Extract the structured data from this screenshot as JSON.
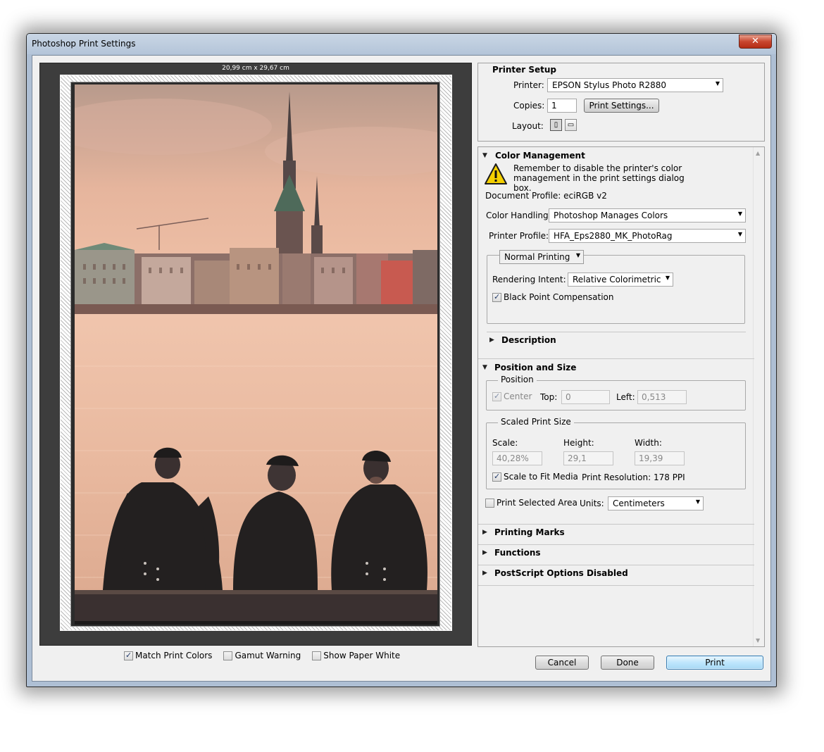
{
  "window": {
    "title": "Photoshop Print Settings",
    "close_label": "✕"
  },
  "preview": {
    "paper_size": "20,99 cm x 29,67 cm",
    "options": [
      {
        "label": "Match Print Colors",
        "checked": true
      },
      {
        "label": "Gamut Warning",
        "checked": false
      },
      {
        "label": "Show Paper White",
        "checked": false
      }
    ]
  },
  "printer_setup": {
    "title": "Printer Setup",
    "printer_label": "Printer:",
    "printer_value": "EPSON Stylus Photo R2880",
    "copies_label": "Copies:",
    "copies_value": "1",
    "print_settings_button": "Print Settings...",
    "layout_label": "Layout:"
  },
  "color_management": {
    "title": "Color Management",
    "warning": "Remember to disable the printer's color management in the print settings dialog box.",
    "document_profile": "Document Profile: eciRGB v2",
    "color_handling_label": "Color Handling:",
    "color_handling_value": "Photoshop Manages Colors",
    "printer_profile_label": "Printer Profile:",
    "printer_profile_value": "HFA_Eps2880_MK_PhotoRag",
    "mode_value": "Normal Printing",
    "rendering_intent_label": "Rendering Intent:",
    "rendering_intent_value": "Relative Colorimetric",
    "black_point_label": "Black Point Compensation",
    "black_point_checked": true,
    "description_title": "Description"
  },
  "position_size": {
    "title": "Position and Size",
    "position_legend": "Position",
    "center_label": "Center",
    "top_label": "Top:",
    "top_value": "0",
    "left_label": "Left:",
    "left_value": "0,513",
    "scaled_legend": "Scaled Print Size",
    "scale_label": "Scale:",
    "scale_value": "40,28%",
    "height_label": "Height:",
    "height_value": "29,1",
    "width_label": "Width:",
    "width_value": "19,39",
    "scale_to_fit_label": "Scale to Fit Media",
    "print_resolution": "Print Resolution: 178 PPI",
    "print_selected_label": "Print Selected Area",
    "units_label": "Units:",
    "units_value": "Centimeters"
  },
  "collapsed_sections": [
    "Printing Marks",
    "Functions",
    "PostScript Options Disabled"
  ],
  "buttons": {
    "cancel": "Cancel",
    "done": "Done",
    "print": "Print"
  },
  "colors": {
    "window_frame": "#aebfd4",
    "close_button": "#c8462f",
    "default_button": "#a7d9f5"
  },
  "icons": {
    "close": "close-icon",
    "warning": "warning-icon",
    "dropdown": "chevron-down-icon",
    "expanded": "triangle-down-icon",
    "collapsed": "triangle-right-icon",
    "layout_portrait": "layout-portrait-icon",
    "layout_landscape": "layout-landscape-icon"
  }
}
